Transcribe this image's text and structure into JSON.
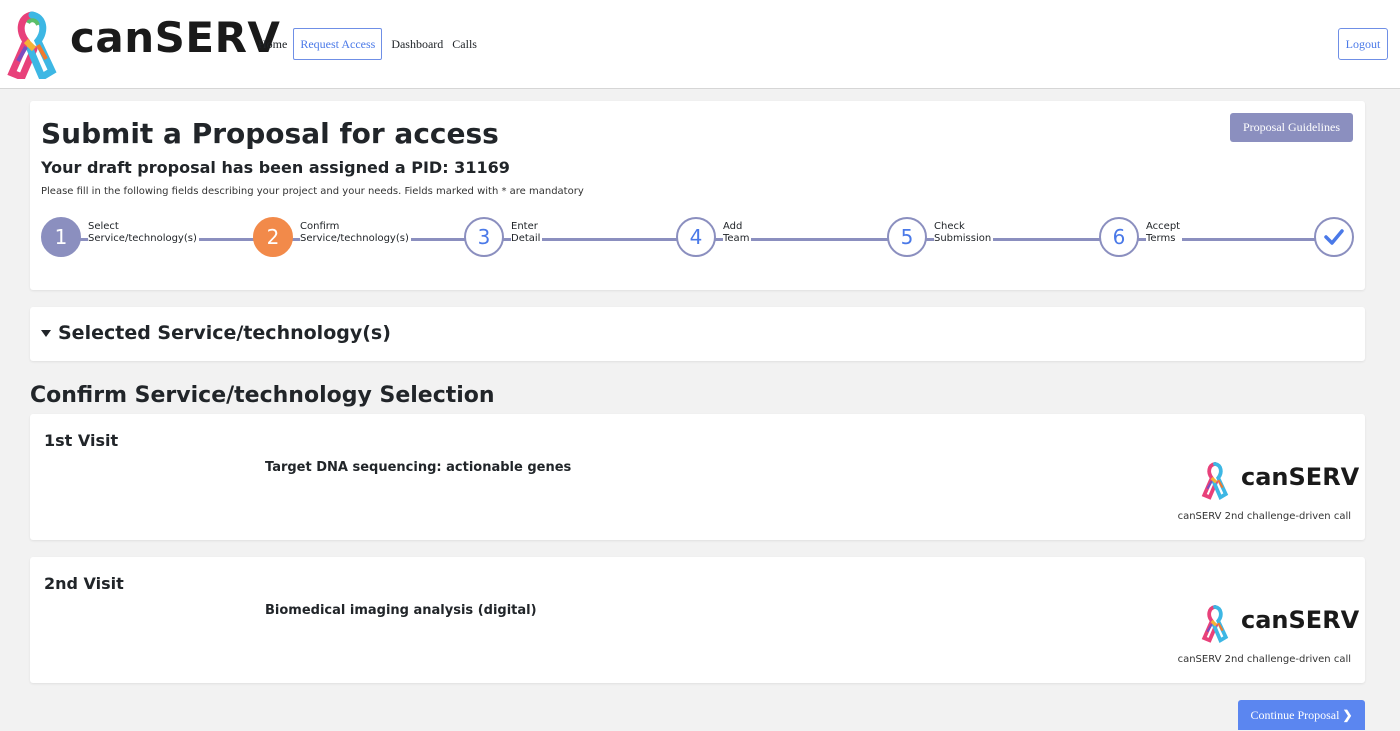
{
  "header": {
    "brand": "canSERV",
    "nav": [
      {
        "label": "Home"
      },
      {
        "label": "Request Access"
      },
      {
        "label": "Dashboard"
      },
      {
        "label": "Calls"
      }
    ],
    "logout_label": "Logout"
  },
  "proposal": {
    "title": "Submit a Proposal for access",
    "pid_text": "Your draft proposal has been assigned a PID: 31169",
    "hint": "Please fill in the following fields describing your project and your needs. Fields marked with * are mandatory",
    "guidelines_label": "Proposal Guidelines"
  },
  "steps": [
    {
      "num": "1",
      "line1": "Select",
      "line2": "Service/technology(s)",
      "state": "done"
    },
    {
      "num": "2",
      "line1": "Confirm",
      "line2": "Service/technology(s)",
      "state": "current"
    },
    {
      "num": "3",
      "line1": "Enter",
      "line2": "Detail",
      "state": "todo"
    },
    {
      "num": "4",
      "line1": "Add",
      "line2": "Team",
      "state": "todo"
    },
    {
      "num": "5",
      "line1": "Check",
      "line2": "Submission",
      "state": "todo"
    },
    {
      "num": "6",
      "line1": "Accept",
      "line2": "Terms",
      "state": "todo"
    }
  ],
  "selected_section": {
    "label": "Selected Service/technology(s)",
    "icon": "caret-down-icon"
  },
  "confirm_section": {
    "title": "Confirm Service/technology Selection"
  },
  "visits": [
    {
      "label": "1st Visit",
      "service": "Target DNA sequencing: actionable genes",
      "brand": "canSERV",
      "call": "canSERV 2nd challenge-driven call"
    },
    {
      "label": "2nd Visit",
      "service": "Biomedical imaging analysis (digital)",
      "brand": "canSERV",
      "call": "canSERV 2nd challenge-driven call"
    }
  ],
  "continue_label": "Continue Proposal",
  "colors": {
    "accent": "#4a79e8",
    "stepper": "#8b8fbf",
    "current_step": "#f28a4a",
    "continue_bg": "#5b86f0"
  }
}
